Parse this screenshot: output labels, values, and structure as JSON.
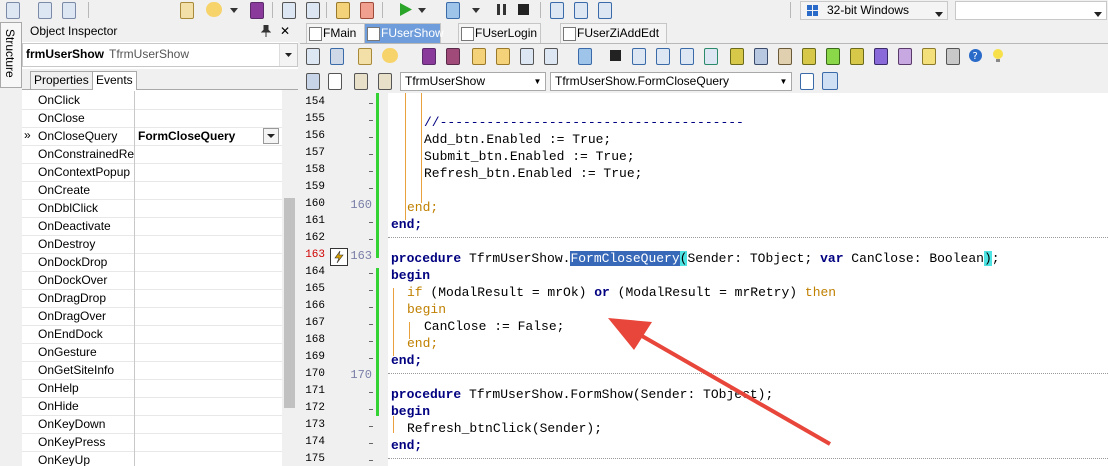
{
  "top_toolbar": {
    "platform_combo": "32-bit Windows"
  },
  "structure_tab": {
    "label": "Structure"
  },
  "object_inspector": {
    "title": "Object Inspector",
    "selected_name": "frmUserShow",
    "selected_class": "TfrmUserShow",
    "tabs": [
      "Properties",
      "Events"
    ],
    "events": [
      {
        "name": "OnClick",
        "value": ""
      },
      {
        "name": "OnClose",
        "value": ""
      },
      {
        "name": "OnCloseQuery",
        "value": "FormCloseQuery",
        "selected": true
      },
      {
        "name": "OnConstrainedRes",
        "value": ""
      },
      {
        "name": "OnContextPopup",
        "value": ""
      },
      {
        "name": "OnCreate",
        "value": ""
      },
      {
        "name": "OnDblClick",
        "value": ""
      },
      {
        "name": "OnDeactivate",
        "value": ""
      },
      {
        "name": "OnDestroy",
        "value": ""
      },
      {
        "name": "OnDockDrop",
        "value": ""
      },
      {
        "name": "OnDockOver",
        "value": ""
      },
      {
        "name": "OnDragDrop",
        "value": ""
      },
      {
        "name": "OnDragOver",
        "value": ""
      },
      {
        "name": "OnEndDock",
        "value": ""
      },
      {
        "name": "OnGesture",
        "value": ""
      },
      {
        "name": "OnGetSiteInfo",
        "value": ""
      },
      {
        "name": "OnHelp",
        "value": ""
      },
      {
        "name": "OnHide",
        "value": ""
      },
      {
        "name": "OnKeyDown",
        "value": ""
      },
      {
        "name": "OnKeyPress",
        "value": ""
      },
      {
        "name": "OnKeyUp",
        "value": ""
      }
    ],
    "selected_marker": "»"
  },
  "editor": {
    "tabs": [
      "FMain",
      "FUserShow",
      "FUserLogin",
      "FUserZiAddEdt"
    ],
    "active_tab": "FUserShow",
    "class_combo": "TfrmUserShow",
    "method_combo": "TfrmUserShow.FormCloseQuery",
    "line_numbers": [
      "154",
      "155",
      "156",
      "157",
      "158",
      "159",
      "160",
      "161",
      "162",
      "163",
      "164",
      "165",
      "166",
      "167",
      "168",
      "169",
      "170",
      "171",
      "172",
      "173",
      "174",
      "175"
    ],
    "big_line_numbers": [
      "160",
      "163",
      "170"
    ],
    "code": {
      "l155": "//---------------------------------------",
      "l156": "Add_btn.Enabled := True;",
      "l157": "Submit_btn.Enabled := True;",
      "l158": "Refresh_btn.Enabled := True;",
      "l160": "end;",
      "l161": "end;",
      "l163_kw": "procedure",
      "l163_a": " TfrmUserShow.",
      "l163_hl": "FormCloseQuery",
      "l163_b1": "(",
      "l163_b": "Sender: TObject; ",
      "l163_var": "var",
      "l163_c": " CanClose: Boolean",
      "l163_b2": ")",
      "l163_d": ";",
      "l164": "begin",
      "l165_if": "if",
      "l165_a": " (ModalResult = mrOk) ",
      "l165_or": "or",
      "l165_b": " (ModalResult = mrRetry) ",
      "l165_then": "then",
      "l166": "begin",
      "l167": "CanClose := False;",
      "l168": "end;",
      "l169": "end;",
      "l171_kw": "procedure",
      "l171_a": " TfrmUserShow.FormShow(Sender: TObject);",
      "l172": "begin",
      "l173": "Refresh_btnClick(Sender);",
      "l174": "end;"
    }
  },
  "colors": {
    "keyword": "#000080",
    "control_keyword": "#c08000",
    "selection": "#3769b8",
    "bracket_match": "#4de3e3",
    "modified_bar": "#34d334",
    "annotation_arrow": "#e8463a"
  }
}
